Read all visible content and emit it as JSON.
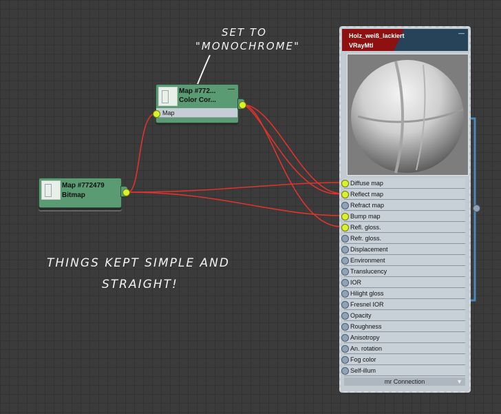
{
  "nodes": {
    "color_correction": {
      "title_line1": "Map #772...",
      "title_line2": "Color Cor...",
      "slot_label": "Map"
    },
    "bitmap": {
      "title_line1": "Map #772479",
      "title_line2": "Bitmap"
    }
  },
  "material": {
    "name": "Holz_weiß_lackiert",
    "type": "VRayMtl",
    "slots": [
      {
        "label": "Diffuse map",
        "connected": true
      },
      {
        "label": "Reflect map",
        "connected": true
      },
      {
        "label": "Refract map",
        "connected": false
      },
      {
        "label": "Bump map",
        "connected": true
      },
      {
        "label": "Refl. gloss.",
        "connected": true
      },
      {
        "label": "Refr. gloss.",
        "connected": false
      },
      {
        "label": "Displacement",
        "connected": false
      },
      {
        "label": "Environment",
        "connected": false
      },
      {
        "label": "Translucency",
        "connected": false
      },
      {
        "label": "IOR",
        "connected": false
      },
      {
        "label": "Hilight gloss",
        "connected": false
      },
      {
        "label": "Fresnel IOR",
        "connected": false
      },
      {
        "label": "Opacity",
        "connected": false
      },
      {
        "label": "Roughness",
        "connected": false
      },
      {
        "label": "Anisotropy",
        "connected": false
      },
      {
        "label": "An. rotation",
        "connected": false
      },
      {
        "label": "Fog color",
        "connected": false
      },
      {
        "label": "Self-illum",
        "connected": false
      }
    ],
    "footer": "mr Connection"
  },
  "annotations": {
    "note1_line1": "SET TO",
    "note1_line2": "\"MONOCHROME\"",
    "note2_line1": "THINGS KEPT SIMPLE AND",
    "note2_line2": "STRAIGHT!"
  },
  "colors": {
    "wire": "#e0332c",
    "node_green": "#5a9b74",
    "socket_active": "#d9f22a"
  }
}
